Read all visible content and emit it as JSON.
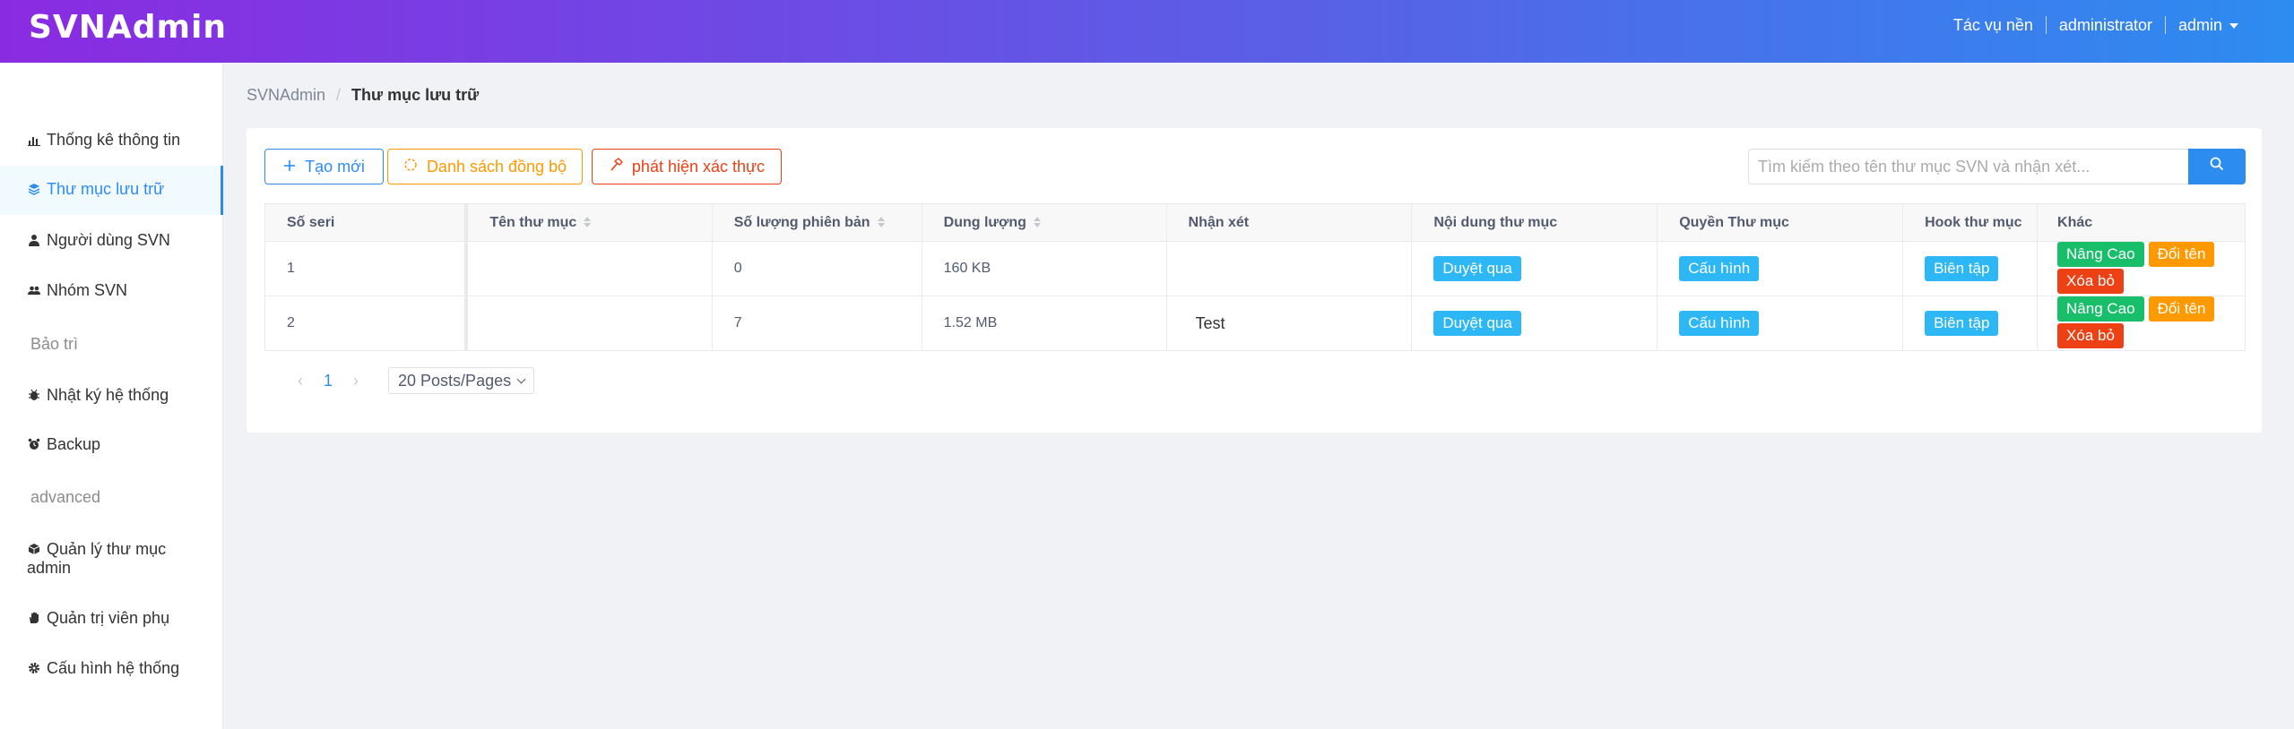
{
  "app": {
    "logo": "SVNAdmin"
  },
  "header": {
    "tasks": "Tác vụ nền",
    "role": "administrator",
    "user": "admin"
  },
  "sidebar": {
    "items": [
      {
        "label": "Thống kê thông tin",
        "icon": "bar-chart-icon"
      },
      {
        "label": "Thư mục lưu trữ",
        "icon": "layers-icon",
        "active": true
      },
      {
        "label": "Người dùng SVN",
        "icon": "person-icon"
      },
      {
        "label": "Nhóm SVN",
        "icon": "people-icon"
      },
      {
        "label": "Nhật ký hệ thống",
        "icon": "bug-icon"
      },
      {
        "label": "Backup",
        "icon": "alarm-icon"
      },
      {
        "label": "Quản lý thư mục admin",
        "icon": "cube-icon"
      },
      {
        "label": "Quản trị viên phụ",
        "icon": "hand-icon"
      },
      {
        "label": "Cấu hình hệ thống",
        "icon": "gear-icon"
      }
    ],
    "groups": [
      "Bảo trì",
      "advanced"
    ]
  },
  "breadcrumb": {
    "root": "SVNAdmin",
    "current": "Thư mục lưu trữ"
  },
  "toolbar": {
    "new_label": "Tạo mới",
    "sync_label": "Danh sách đồng bộ",
    "detect_label": "phát hiện xác thực",
    "search_placeholder": "Tìm kiếm theo tên thư mục SVN và nhận xét..."
  },
  "table": {
    "headers": [
      "Số seri",
      "Tên thư mục",
      "Số lượng phiên bản",
      "Dung lượng",
      "Nhận xét",
      "Nội dung thư mục",
      "Quyền Thư mục",
      "Hook thư mục",
      "Khác"
    ],
    "rows": [
      {
        "serial": "1",
        "name": "",
        "revisions": "0",
        "size": "160 KB",
        "remark": ""
      },
      {
        "serial": "2",
        "name": "",
        "revisions": "7",
        "size": "1.52 MB",
        "remark": "Test"
      }
    ],
    "actions": {
      "browse": "Duyệt qua",
      "config": "Cấu hình",
      "edit": "Biên tập",
      "advanced": "Nâng Cao",
      "rename": "Đổi tên",
      "delete": "Xóa bỏ"
    }
  },
  "pagination": {
    "current": "1",
    "page_size": "20 Posts/Pages"
  },
  "colors": {
    "primary": "#2d8cf0",
    "warning": "#ff9900",
    "error": "#ed4014",
    "success": "#19be6b",
    "info": "#2db7f5"
  }
}
